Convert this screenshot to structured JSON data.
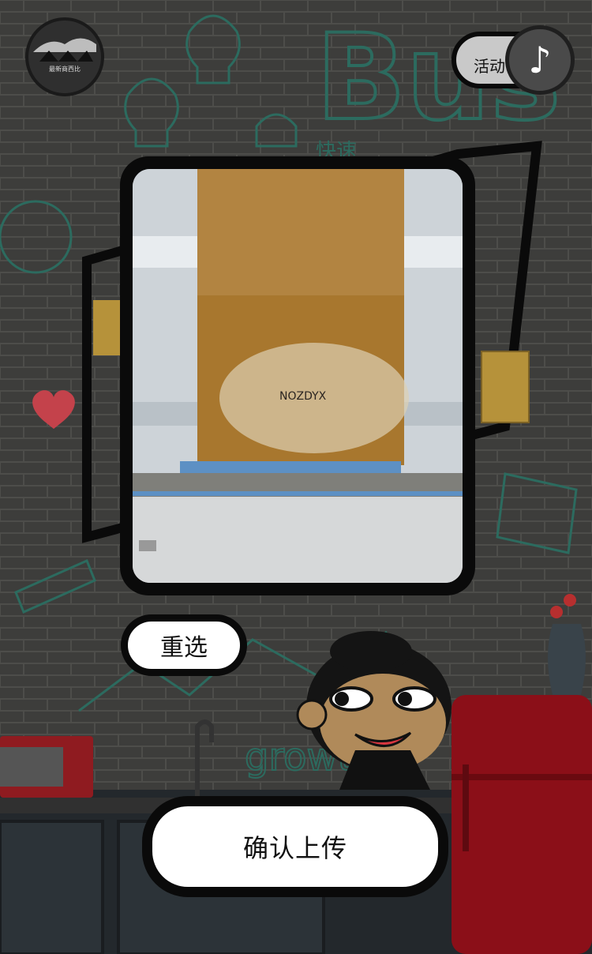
{
  "header": {
    "logo_label": "最新商西比",
    "activity_label": "活动",
    "music_icon": "music-note-icon"
  },
  "upload": {
    "photo_mark": "NOZDYX",
    "reselect_label": "重选",
    "confirm_label": "确认上传"
  },
  "decor": {
    "wall_word": "Bus",
    "growth_word": "growt",
    "sticker_text": "快速"
  },
  "colors": {
    "background": "#3c3c3a",
    "doodle": "#2c6b5f",
    "fridge": "#8b0f18",
    "button": "#ffffff",
    "border": "#0a0a0a"
  }
}
